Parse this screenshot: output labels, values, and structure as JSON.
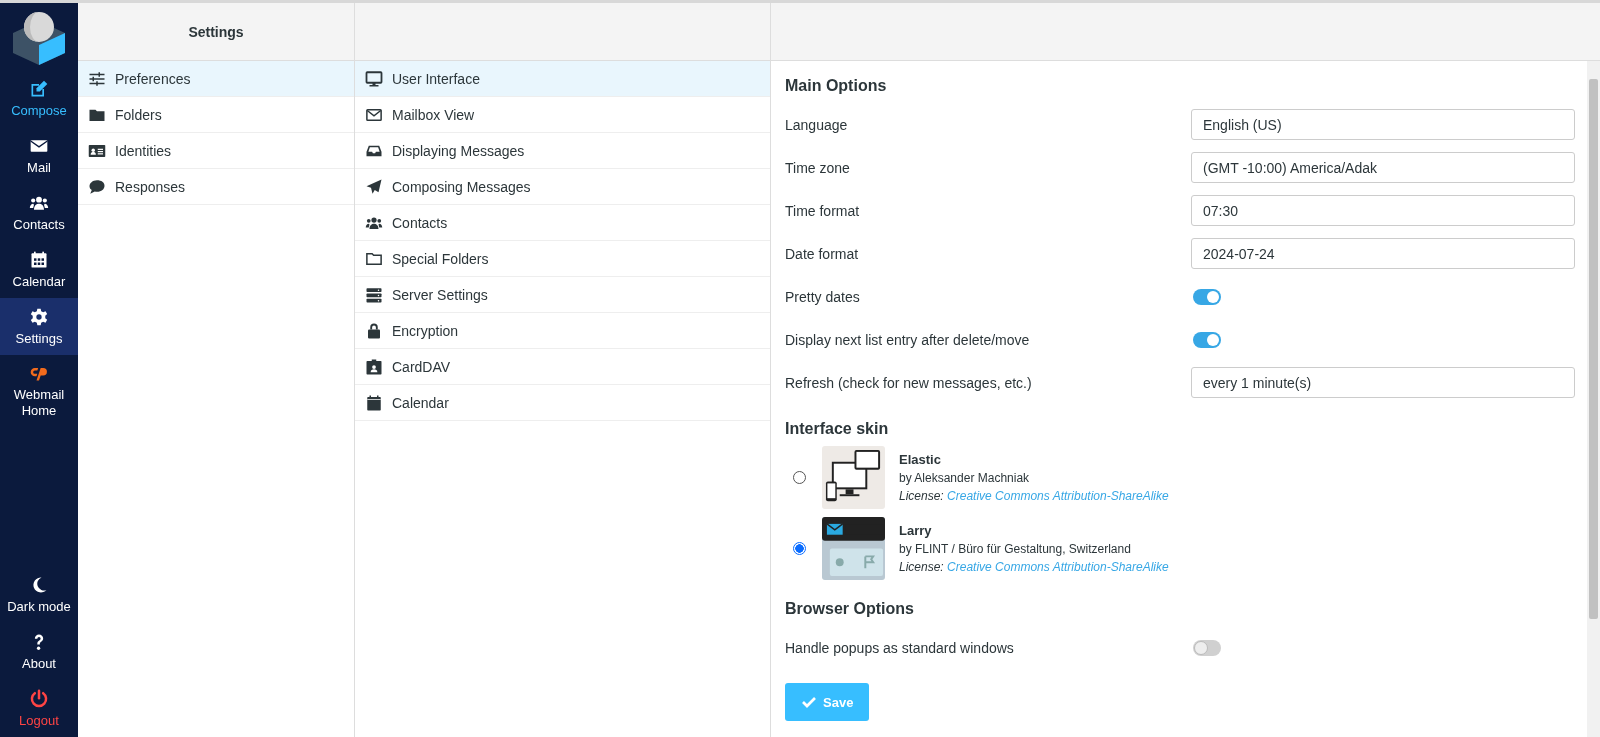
{
  "nav": {
    "top": [
      {
        "label": "Compose",
        "kind": "primary",
        "selected": false
      },
      {
        "label": "Mail",
        "kind": "normal",
        "selected": false
      },
      {
        "label": "Contacts",
        "kind": "normal",
        "selected": false
      },
      {
        "label": "Calendar",
        "kind": "normal",
        "selected": false
      },
      {
        "label": "Settings",
        "kind": "normal",
        "selected": true
      },
      {
        "label": "Webmail Home",
        "kind": "normal",
        "selected": false
      }
    ],
    "bottom": [
      {
        "label": "Dark mode",
        "kind": "normal"
      },
      {
        "label": "About",
        "kind": "normal"
      },
      {
        "label": "Logout",
        "kind": "danger"
      }
    ]
  },
  "settings": {
    "title": "Settings",
    "items": [
      {
        "label": "Preferences",
        "selected": true
      },
      {
        "label": "Folders",
        "selected": false
      },
      {
        "label": "Identities",
        "selected": false
      },
      {
        "label": "Responses",
        "selected": false
      }
    ]
  },
  "sections": [
    {
      "label": "User Interface",
      "selected": true
    },
    {
      "label": "Mailbox View",
      "selected": false
    },
    {
      "label": "Displaying Messages",
      "selected": false
    },
    {
      "label": "Composing Messages",
      "selected": false
    },
    {
      "label": "Contacts",
      "selected": false
    },
    {
      "label": "Special Folders",
      "selected": false
    },
    {
      "label": "Server Settings",
      "selected": false
    },
    {
      "label": "Encryption",
      "selected": false
    },
    {
      "label": "CardDAV",
      "selected": false
    },
    {
      "label": "Calendar",
      "selected": false
    }
  ],
  "main_options": {
    "title": "Main Options",
    "rows": [
      {
        "label": "Language",
        "kind": "select",
        "value": "English (US)"
      },
      {
        "label": "Time zone",
        "kind": "select",
        "value": "(GMT -10:00) America/Adak"
      },
      {
        "label": "Time format",
        "kind": "select",
        "value": "07:30"
      },
      {
        "label": "Date format",
        "kind": "select",
        "value": "2024-07-24"
      },
      {
        "label": "Pretty dates",
        "kind": "toggle",
        "on": true
      },
      {
        "label": "Display next list entry after delete/move",
        "kind": "toggle",
        "on": true
      },
      {
        "label": "Refresh (check for new messages, etc.)",
        "kind": "select",
        "value": "every 1 minute(s)"
      }
    ]
  },
  "interface_skin": {
    "title": "Interface skin",
    "skins": [
      {
        "name": "Elastic",
        "author": "by Aleksander Machniak",
        "license_label": "License:",
        "license": "Creative Commons Attribution-ShareAlike",
        "selected": false
      },
      {
        "name": "Larry",
        "author": "by FLINT / Büro für Gestaltung, Switzerland",
        "license_label": "License:",
        "license": "Creative Commons Attribution-ShareAlike",
        "selected": true
      }
    ]
  },
  "browser_options": {
    "title": "Browser Options",
    "rows": [
      {
        "label": "Handle popups as standard windows",
        "kind": "toggle",
        "on": false
      }
    ]
  },
  "save_button": "Save"
}
